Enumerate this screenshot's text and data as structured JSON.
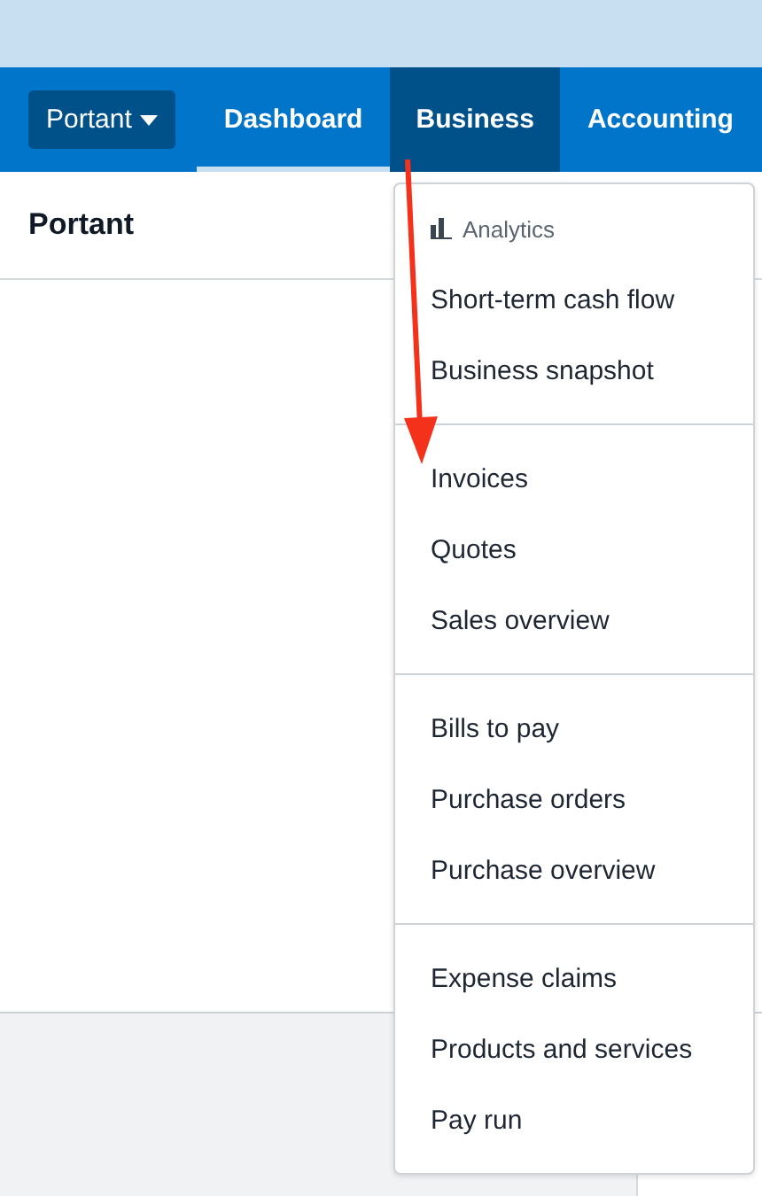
{
  "org_switcher": {
    "label": "Portant"
  },
  "nav": [
    {
      "label": "Dashboard",
      "selected": false,
      "current": true
    },
    {
      "label": "Business",
      "selected": true,
      "current": false
    },
    {
      "label": "Accounting",
      "selected": false,
      "current": false
    }
  ],
  "page": {
    "title": "Portant"
  },
  "menu": {
    "sections": [
      {
        "heading": "Analytics",
        "items": [
          "Short-term cash flow",
          "Business snapshot"
        ]
      },
      {
        "items": [
          "Invoices",
          "Quotes",
          "Sales overview"
        ]
      },
      {
        "items": [
          "Bills to pay",
          "Purchase orders",
          "Purchase overview"
        ]
      },
      {
        "items": [
          "Expense claims",
          "Products and services",
          "Pay run"
        ]
      }
    ]
  },
  "annotation": {
    "kind": "arrow"
  }
}
